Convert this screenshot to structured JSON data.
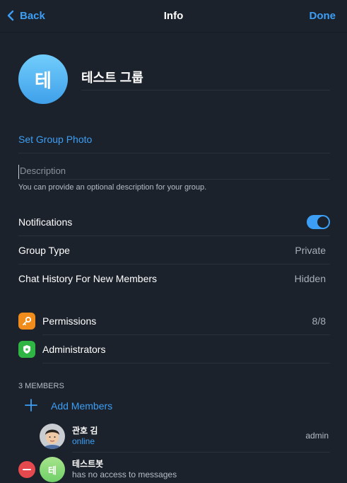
{
  "header": {
    "back_label": "Back",
    "title": "Info",
    "done_label": "Done"
  },
  "group": {
    "avatar_letter": "테",
    "name": "테스트 그룹",
    "set_photo_label": "Set Group Photo",
    "description_placeholder": "Description",
    "description_hint": "You can provide an optional description for your group."
  },
  "settings": {
    "notifications_label": "Notifications",
    "notifications_on": true,
    "group_type_label": "Group Type",
    "group_type_value": "Private",
    "chat_history_label": "Chat History For New Members",
    "chat_history_value": "Hidden"
  },
  "admin": {
    "permissions_label": "Permissions",
    "permissions_value": "8/8",
    "administrators_label": "Administrators"
  },
  "members": {
    "header": "3 MEMBERS",
    "add_label": "Add Members",
    "list": [
      {
        "name": "관호 김",
        "status": "online",
        "role": "admin"
      },
      {
        "avatar_letter": "테",
        "name": "테스트봇",
        "status": "has no access to messages"
      }
    ]
  },
  "colors": {
    "accent": "#3c9ff5",
    "background": "#1c222c",
    "permissions_icon": "#f08c1b",
    "administrators_icon": "#2fb544",
    "remove": "#e5484d"
  }
}
